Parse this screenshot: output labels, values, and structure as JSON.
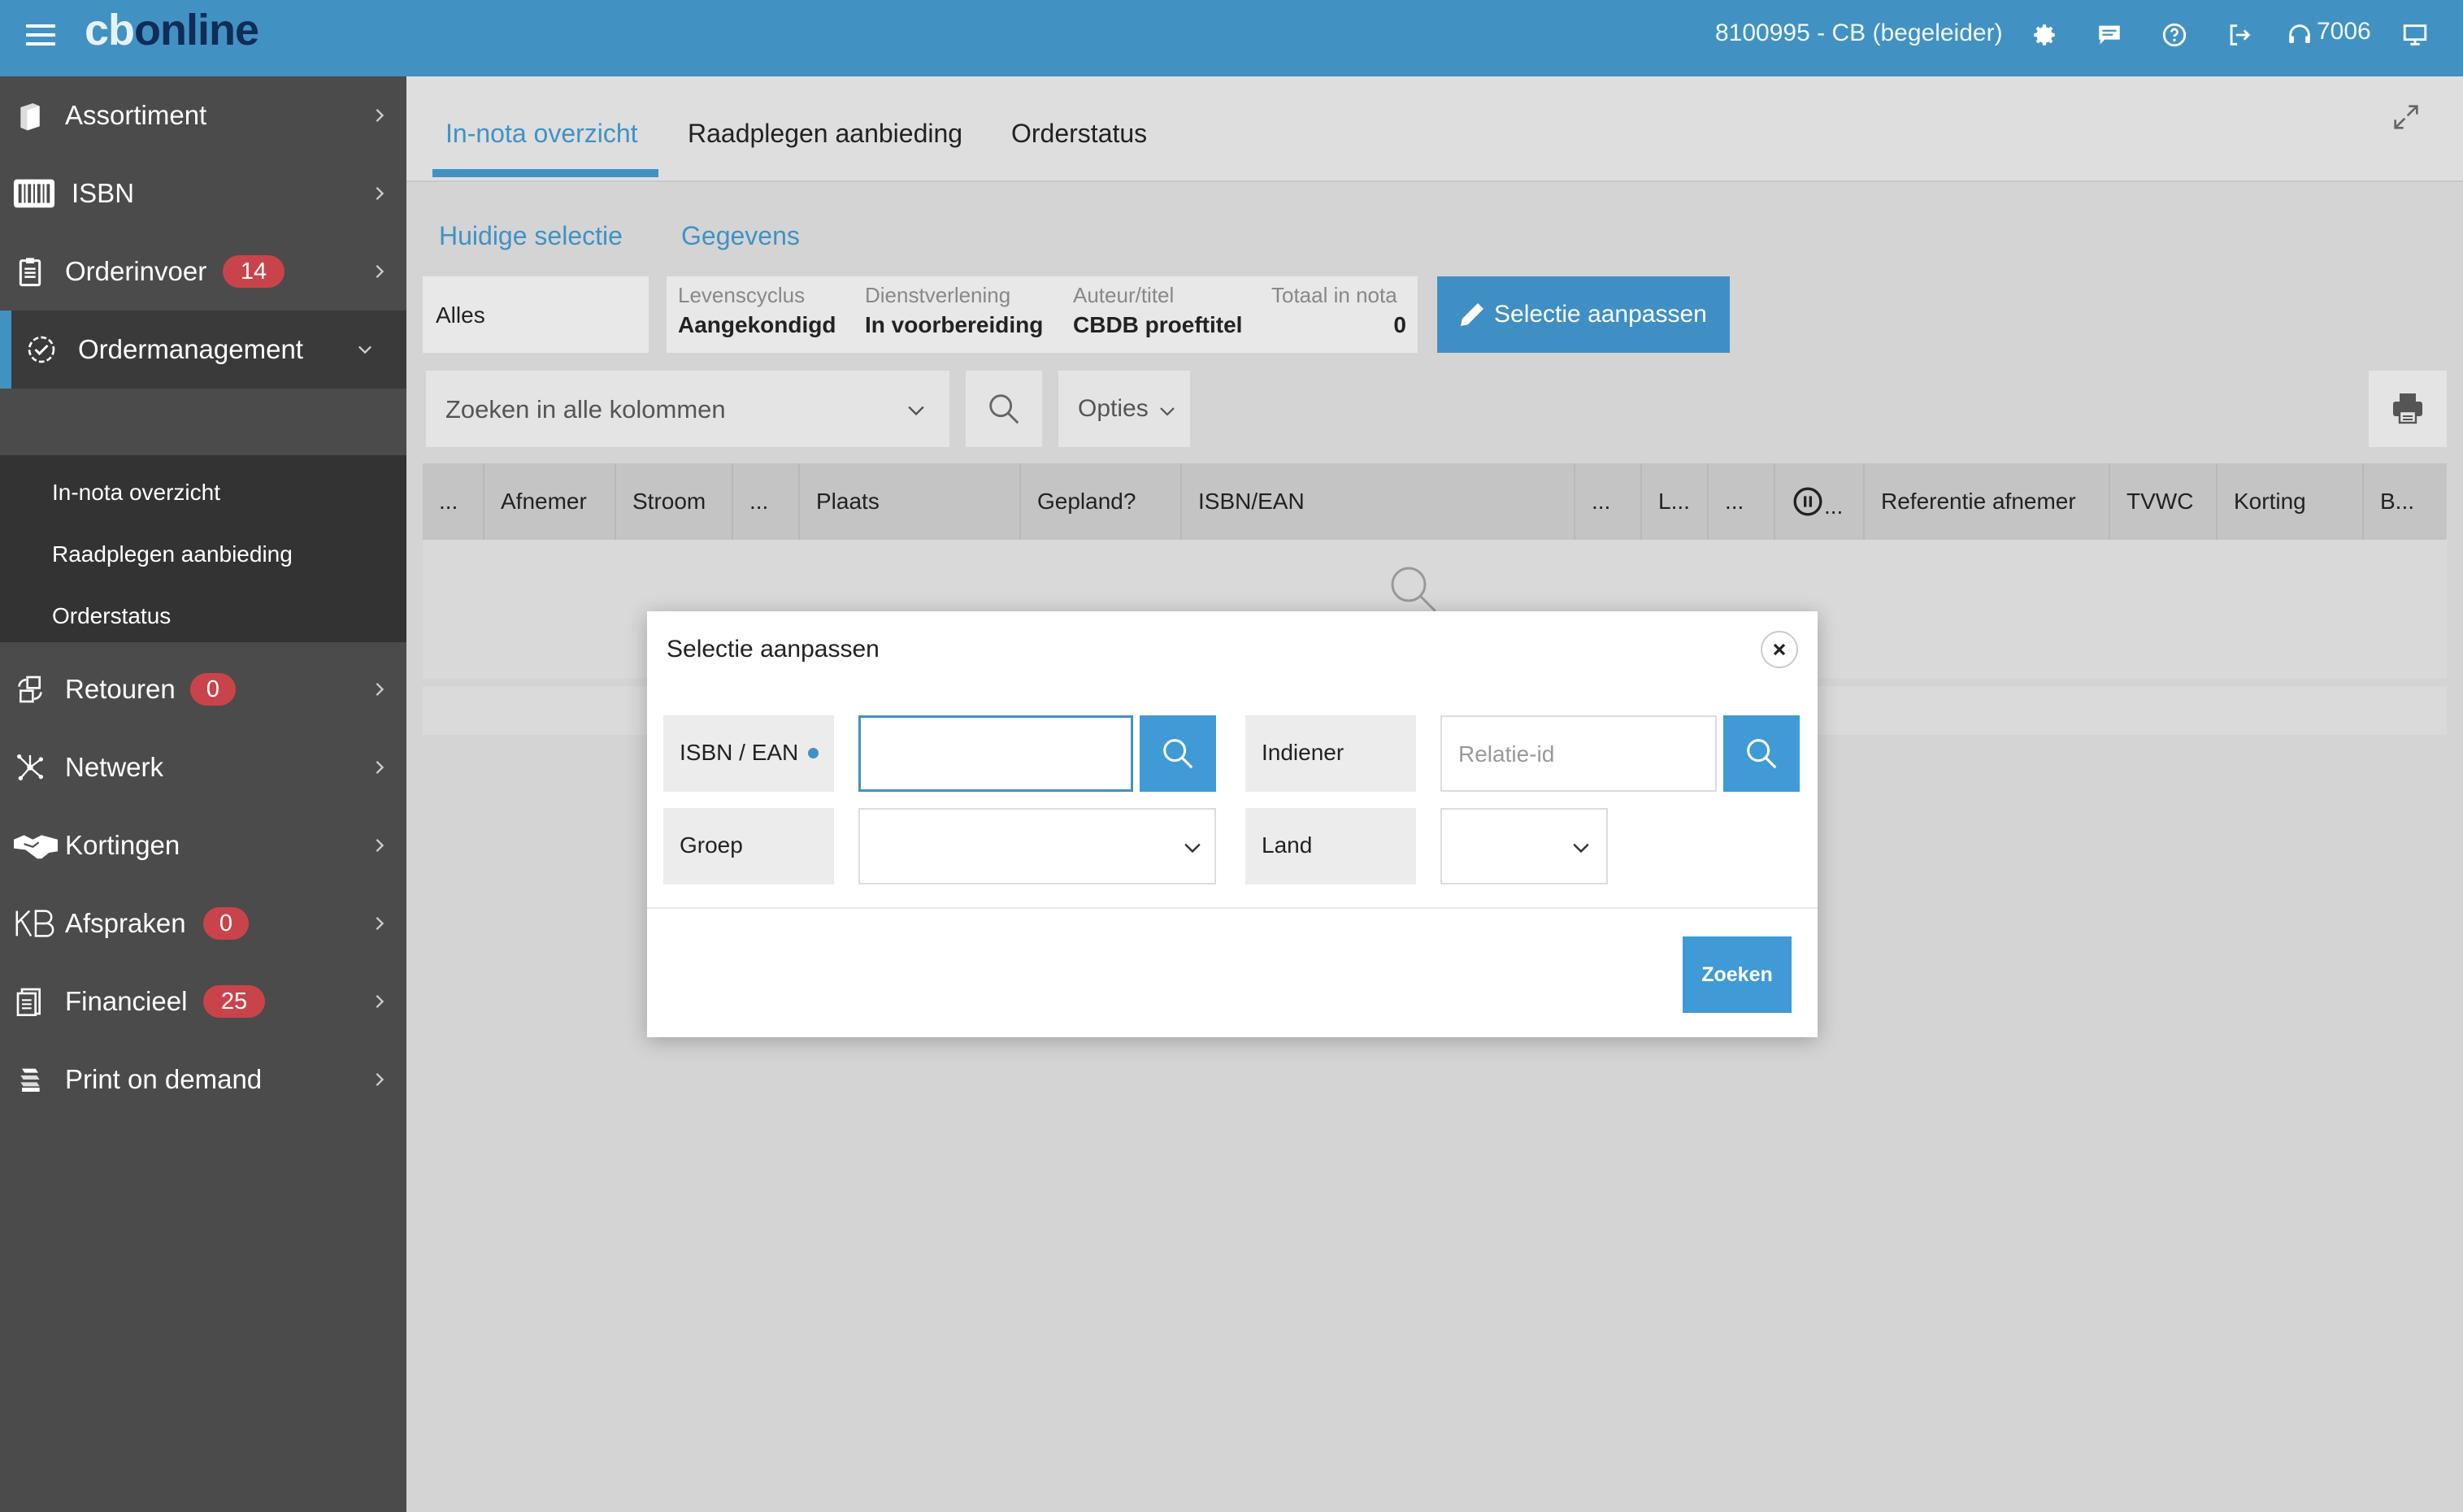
{
  "app": {
    "logo_cb": "cb",
    "logo_online": "online",
    "user": "8100995 - CB (begeleider)",
    "extension": "7006"
  },
  "sidebar": {
    "items": [
      {
        "label": "Assortiment",
        "icon": "book-icon"
      },
      {
        "label": "ISBN",
        "icon": "barcode-icon"
      },
      {
        "label": "Orderinvoer",
        "icon": "clipboard-icon",
        "badge": "14"
      },
      {
        "label": "Ordermanagement",
        "icon": "check-circle-icon"
      },
      {
        "label": "Retouren",
        "icon": "returns-icon",
        "badge": "0"
      },
      {
        "label": "Netwerk",
        "icon": "network-icon"
      },
      {
        "label": "Kortingen",
        "icon": "handshake-icon"
      },
      {
        "label": "Afspraken",
        "icon": "kb-logo-icon",
        "badge": "0"
      },
      {
        "label": "Financieel",
        "icon": "invoice-icon",
        "badge": "25"
      },
      {
        "label": "Print on demand",
        "icon": "paper-stack-icon"
      }
    ],
    "subitems": [
      "In-nota overzicht",
      "Raadplegen aanbieding",
      "Orderstatus"
    ]
  },
  "tabs": [
    "In-nota overzicht",
    "Raadplegen aanbieding",
    "Orderstatus"
  ],
  "subtabs": [
    "Huidige selectie",
    "Gegevens"
  ],
  "selection": {
    "alles": "Alles",
    "columns": [
      {
        "label": "Levenscyclus",
        "value": "Aangekondigd"
      },
      {
        "label": "Dienstverlening",
        "value": "In voorbereiding"
      },
      {
        "label": "Auteur/titel",
        "value": "CBDB proeftitel"
      },
      {
        "label": "Totaal in nota",
        "value": "0"
      }
    ],
    "adjust_button": "Selectie aanpassen"
  },
  "toolbar": {
    "search_placeholder": "Zoeken in alle kolommen",
    "options_label": "Opties"
  },
  "table": {
    "headers": [
      "...",
      "Afnemer",
      "Stroom",
      "...",
      "Plaats",
      "Gepland?",
      "ISBN/EAN",
      "...",
      "L...",
      "...",
      "...",
      "Referentie afnemer",
      "TVWC",
      "Korting",
      "B..."
    ]
  },
  "modal": {
    "title": "Selectie aanpassen",
    "isbn_label": "ISBN / EAN",
    "isbn_value": "",
    "indiener_label": "Indiener",
    "relatie_placeholder": "Relatie-id",
    "groep_label": "Groep",
    "groep_value": "",
    "land_label": "Land",
    "land_value": "",
    "submit_label": "Zoeken"
  },
  "colors": {
    "primary": "#4192c3",
    "sidebar": "#4b4b4b",
    "badge": "#c9444a",
    "brand_dark": "#0f2d57"
  }
}
